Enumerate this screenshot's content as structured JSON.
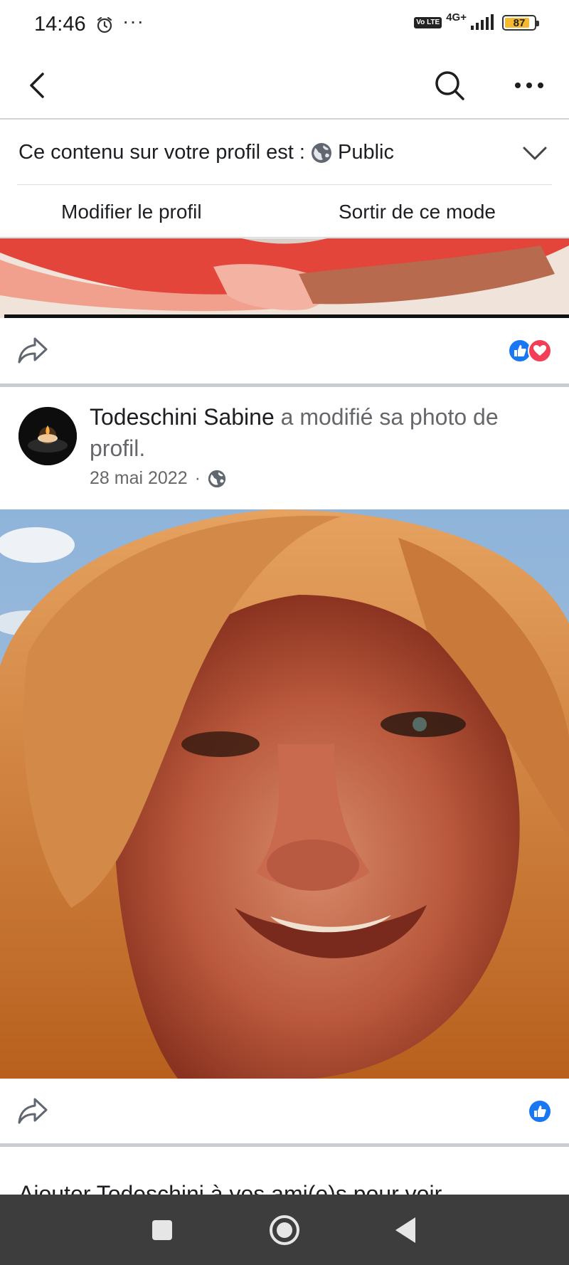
{
  "status_bar": {
    "time": "14:46",
    "alarm_icon": "alarm-icon",
    "more_indicator": "···",
    "volte": "Vo LTE",
    "network": "4G+",
    "battery": "87",
    "battery_level": 0.87
  },
  "nav": {
    "back_icon": "chevron-left-icon",
    "search_icon": "search-icon",
    "more_icon": "more-horizontal-icon"
  },
  "privacy": {
    "text": "Ce contenu sur votre profil est :",
    "audience": "Public",
    "dropdown_icon": "chevron-down-icon"
  },
  "mode_actions": {
    "edit_profile": "Modifier le profil",
    "exit_mode": "Sortir de ce mode"
  },
  "post1": {
    "share_icon": "share-icon",
    "reactions": [
      "like",
      "love"
    ]
  },
  "post2": {
    "author": "Todeschini Sabine",
    "action": "a modifié sa photo de profil.",
    "date": "28 mai 2022",
    "separator": "·",
    "audience_icon": "globe-icon",
    "share_icon": "share-icon",
    "reactions": [
      "like"
    ]
  },
  "next_post_partial": "Ajouter Todeschini à vos ami(e)s pour voir",
  "colors": {
    "like_blue": "#1877f2",
    "love_red": "#f33e58",
    "secondary_text": "#65676b",
    "android_nav": "#3d3d3d"
  }
}
